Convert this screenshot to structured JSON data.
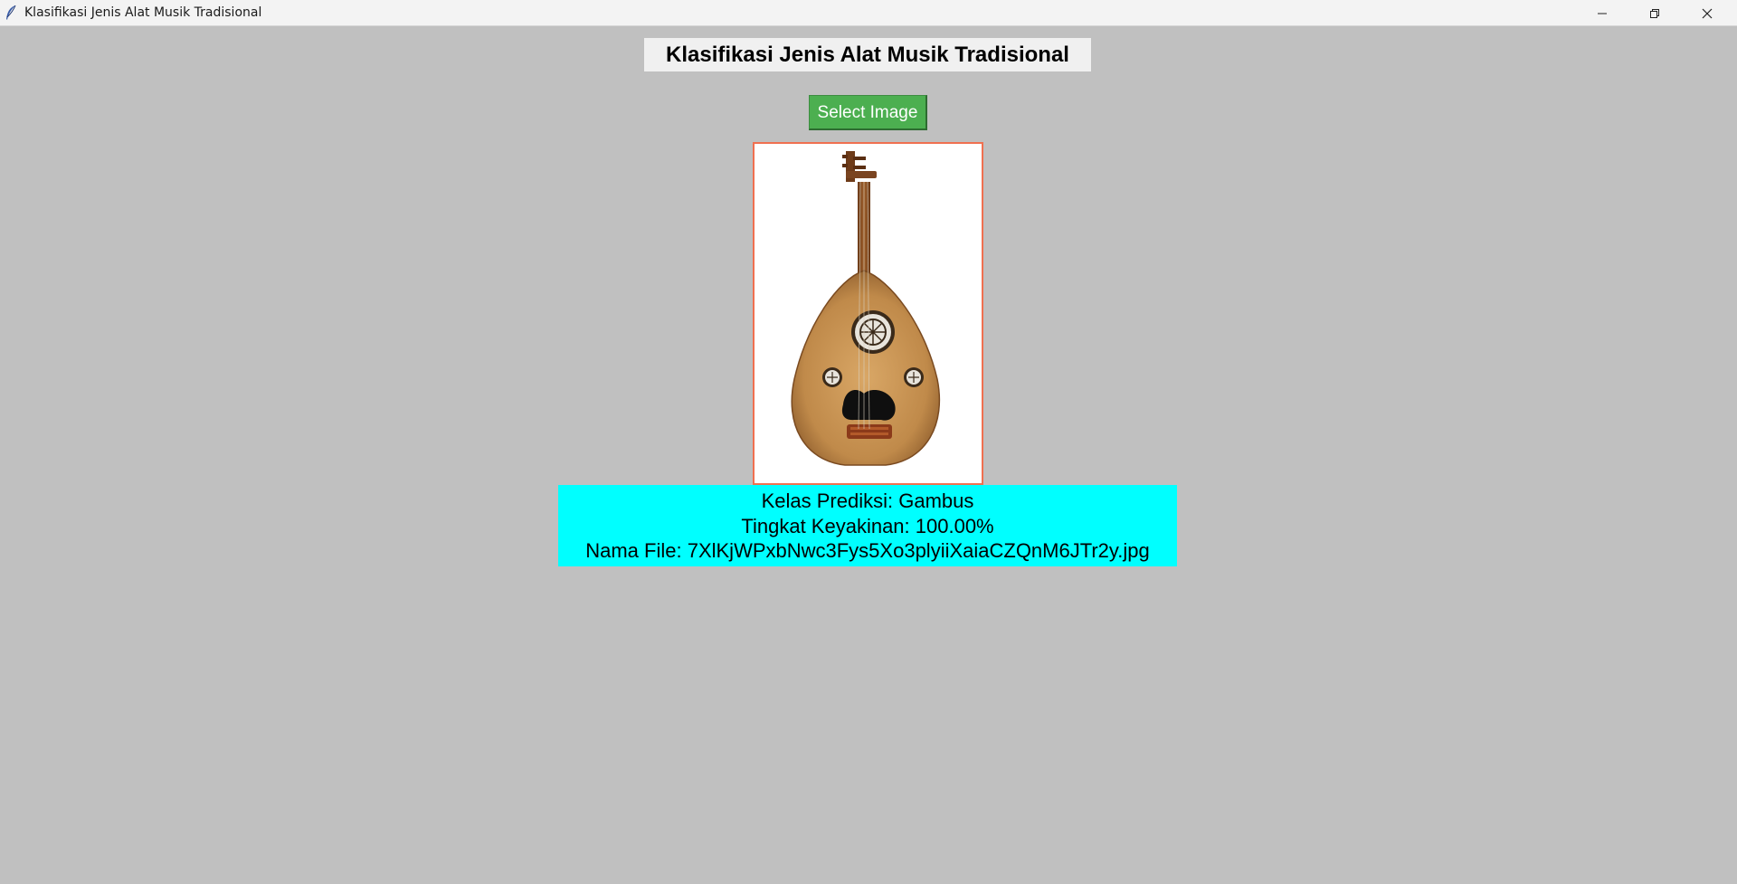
{
  "window": {
    "title": "Klasifikasi Jenis Alat Musik Tradisional",
    "controls": [
      "minimize-icon",
      "restore-icon",
      "close-icon"
    ]
  },
  "main": {
    "heading": "Klasifikasi Jenis Alat Musik Tradisional",
    "select_button_label": "Select Image",
    "preview_image": "oud-gambus-icon",
    "results": {
      "predicted_class": "Kelas Prediksi: Gambus",
      "confidence": "Tingkat Keyakinan: 100.00%",
      "file_name": "Nama File: 7XlKjWPxbNwc3Fys5Xo3plyiiXaiaCZQnM6JTr2y.jpg"
    }
  },
  "colors": {
    "background": "#c0c0c0",
    "button": "#4caf50",
    "result_panel": "#00ffff",
    "image_border": "#f07050"
  }
}
